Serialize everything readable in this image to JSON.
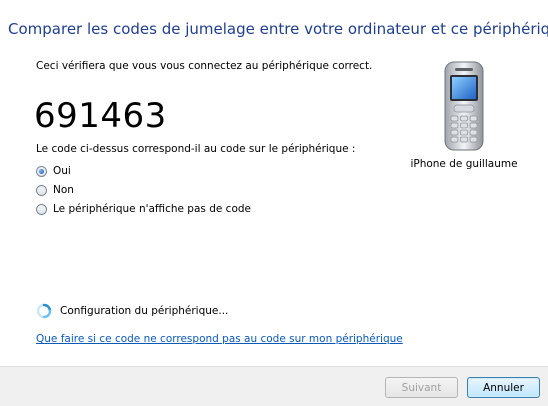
{
  "header": {
    "title": "Comparer les codes de jumelage entre votre ordinateur et ce périphérique"
  },
  "main": {
    "intro": "Ceci vérifiera que vous vous connectez au périphérique correct.",
    "pairing_code": "691463",
    "question": "Le code ci-dessus correspond-il au code sur le périphérique :",
    "options": [
      {
        "label": "Oui",
        "selected": true
      },
      {
        "label": "Non",
        "selected": false
      },
      {
        "label": "Le périphérique n'affiche pas de code",
        "selected": false
      }
    ]
  },
  "device": {
    "name": "iPhone de guillaume",
    "icon": "mobile-phone-icon"
  },
  "status": {
    "text": "Configuration du périphérique...",
    "icon": "spinner-icon"
  },
  "help_link": "Que faire si ce code ne correspond pas au code sur mon périphérique",
  "footer": {
    "next_label": "Suivant",
    "cancel_label": "Annuler",
    "next_enabled": false
  },
  "colors": {
    "title": "#1f3f8e",
    "link": "#0b5aba",
    "footer_bg": "#f0f0f0"
  }
}
